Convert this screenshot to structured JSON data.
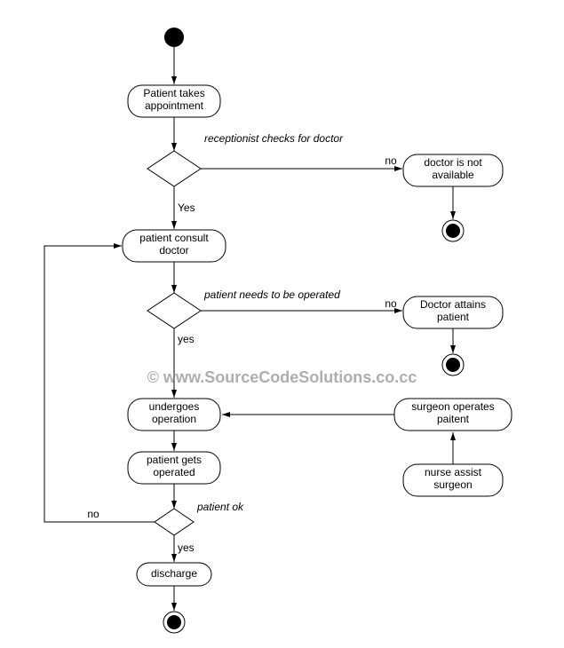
{
  "nodes": {
    "start": "",
    "patient_takes_appointment": "Patient takes\nappointment",
    "receptionist_checks": "receptionist checks for doctor",
    "doctor_not_available": "doctor is not\navailable",
    "patient_consult_doctor": "patient consult\ndoctor",
    "patient_needs_operated": "patient needs to be operated",
    "doctor_attains_patient": "Doctor attains\npatient",
    "undergoes_operation": "undergoes\noperation",
    "surgeon_operates": "surgeon operates\npaitent",
    "patient_gets_operated": "patient gets\noperated",
    "nurse_assist_surgeon": "nurse assist\nsurgeon",
    "patient_ok": "patient ok",
    "discharge": "discharge"
  },
  "edges": {
    "yes1": "Yes",
    "no1": "no",
    "yes2": "yes",
    "no2": "no",
    "yes3": "yes",
    "no3": "no"
  },
  "watermark": "© www.SourceCodeSolutions.co.cc",
  "chart_data": {
    "type": "activity-diagram",
    "title": "",
    "nodes": [
      {
        "id": "start",
        "type": "initial"
      },
      {
        "id": "a1",
        "type": "activity",
        "label": "Patient takes appointment"
      },
      {
        "id": "d1",
        "type": "decision",
        "label": "receptionist checks for doctor"
      },
      {
        "id": "a2",
        "type": "activity",
        "label": "doctor is not available"
      },
      {
        "id": "end1",
        "type": "final"
      },
      {
        "id": "a3",
        "type": "activity",
        "label": "patient consult doctor"
      },
      {
        "id": "d2",
        "type": "decision",
        "label": "patient needs to be operated"
      },
      {
        "id": "a4",
        "type": "activity",
        "label": "Doctor attains patient"
      },
      {
        "id": "end2",
        "type": "final"
      },
      {
        "id": "a5",
        "type": "activity",
        "label": "undergoes operation"
      },
      {
        "id": "a6",
        "type": "activity",
        "label": "surgeon operates paitent"
      },
      {
        "id": "a7",
        "type": "activity",
        "label": "nurse assist surgeon"
      },
      {
        "id": "a8",
        "type": "activity",
        "label": "patient gets operated"
      },
      {
        "id": "d3",
        "type": "decision",
        "label": "patient ok"
      },
      {
        "id": "a9",
        "type": "activity",
        "label": "discharge"
      },
      {
        "id": "end3",
        "type": "final"
      }
    ],
    "edges": [
      {
        "from": "start",
        "to": "a1"
      },
      {
        "from": "a1",
        "to": "d1"
      },
      {
        "from": "d1",
        "to": "a2",
        "label": "no"
      },
      {
        "from": "a2",
        "to": "end1"
      },
      {
        "from": "d1",
        "to": "a3",
        "label": "Yes"
      },
      {
        "from": "a3",
        "to": "d2"
      },
      {
        "from": "d2",
        "to": "a4",
        "label": "no"
      },
      {
        "from": "a4",
        "to": "end2"
      },
      {
        "from": "d2",
        "to": "a5",
        "label": "yes"
      },
      {
        "from": "a7",
        "to": "a6"
      },
      {
        "from": "a6",
        "to": "a5"
      },
      {
        "from": "a5",
        "to": "a8"
      },
      {
        "from": "a8",
        "to": "d3"
      },
      {
        "from": "d3",
        "to": "a9",
        "label": "yes"
      },
      {
        "from": "d3",
        "to": "a3",
        "label": "no"
      },
      {
        "from": "a9",
        "to": "end3"
      }
    ]
  }
}
